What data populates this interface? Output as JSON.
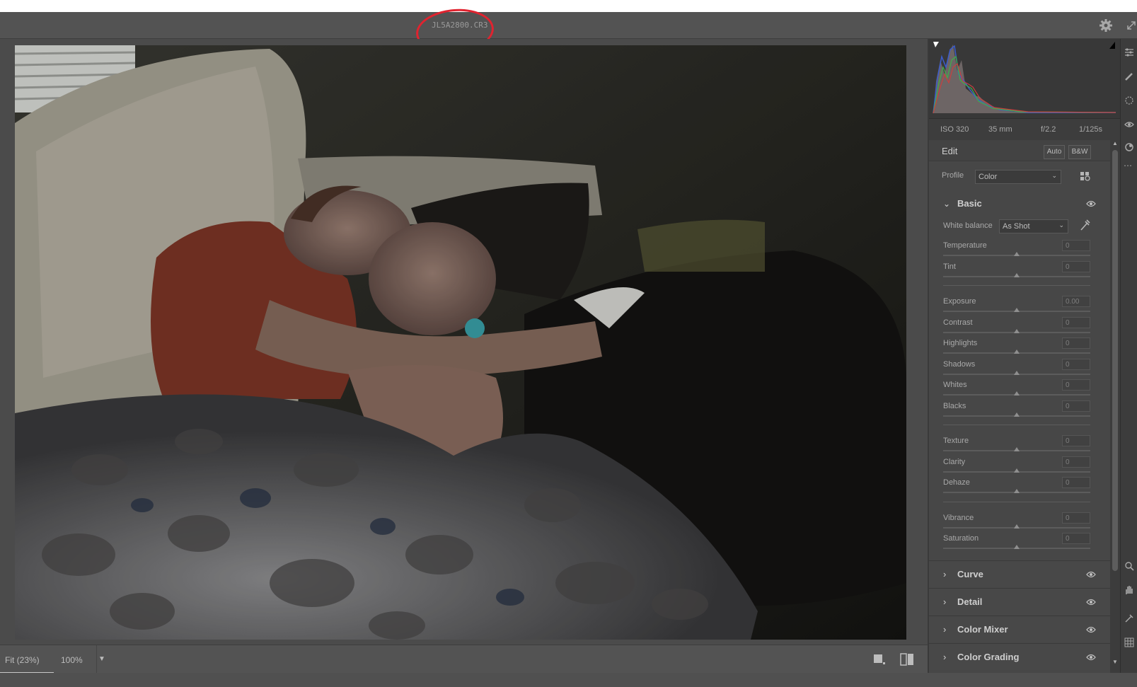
{
  "file": {
    "name": "JL5A2800.CR3"
  },
  "exif": {
    "iso": "ISO 320",
    "focal": "35 mm",
    "aperture": "f/2.2",
    "shutter": "1/125s"
  },
  "edit": {
    "title": "Edit",
    "auto_label": "Auto",
    "bw_label": "B&W"
  },
  "profile": {
    "label": "Profile",
    "value": "Color"
  },
  "basic": {
    "title": "Basic",
    "white_balance": {
      "label": "White balance",
      "value": "As Shot"
    },
    "groups": [
      [
        {
          "label": "Temperature",
          "value": "0"
        },
        {
          "label": "Tint",
          "value": "0"
        }
      ],
      [
        {
          "label": "Exposure",
          "value": "0.00"
        },
        {
          "label": "Contrast",
          "value": "0"
        },
        {
          "label": "Highlights",
          "value": "0"
        },
        {
          "label": "Shadows",
          "value": "0"
        },
        {
          "label": "Whites",
          "value": "0"
        },
        {
          "label": "Blacks",
          "value": "0"
        }
      ],
      [
        {
          "label": "Texture",
          "value": "0"
        },
        {
          "label": "Clarity",
          "value": "0"
        },
        {
          "label": "Dehaze",
          "value": "0"
        }
      ],
      [
        {
          "label": "Vibrance",
          "value": "0"
        },
        {
          "label": "Saturation",
          "value": "0"
        }
      ]
    ]
  },
  "sections": [
    {
      "title": "Curve"
    },
    {
      "title": "Detail"
    },
    {
      "title": "Color Mixer"
    },
    {
      "title": "Color Grading"
    }
  ],
  "zoom": {
    "fit_label": "Fit (23%)",
    "level_label": "100%"
  },
  "colors": {
    "panel": "#474747",
    "background": "#535353",
    "annotation": "#e0232f"
  },
  "icons": [
    "settings-gear-icon",
    "expand-icon",
    "eye-icon",
    "eyedropper-icon",
    "profile-browser-icon",
    "single-view-icon",
    "before-after-icon",
    "edit-sliders-icon",
    "healing-brush-icon",
    "mask-icon",
    "red-eye-icon",
    "presets-icon",
    "more-icon",
    "zoom-icon",
    "hand-icon",
    "sampler-icon",
    "grid-icon"
  ]
}
